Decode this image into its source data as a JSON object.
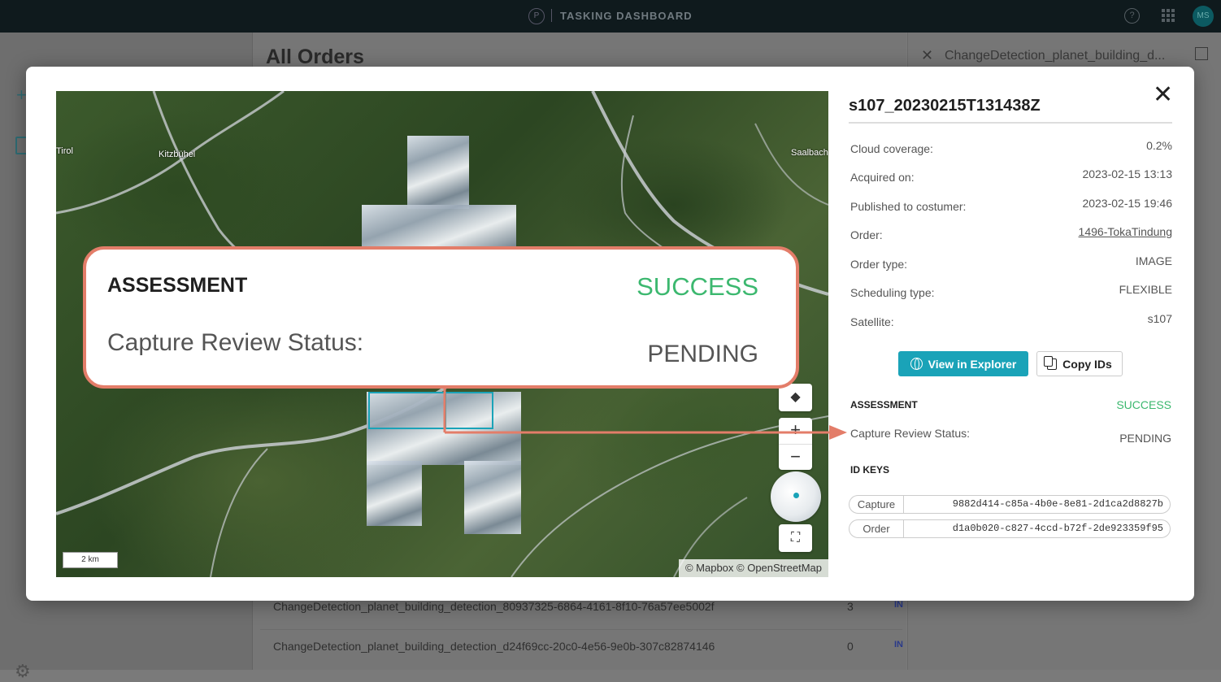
{
  "app": {
    "title": "TASKING DASHBOARD",
    "logo_glyph": "P",
    "avatar_initials": "MS",
    "help_glyph": "?"
  },
  "background": {
    "heading": "All Orders",
    "panel_title": "ChangeDetection_planet_building_d...",
    "rows": [
      {
        "name": "ChangeDetection_planet_building_detection_80937325-6864-4161-8f10-76a57ee5002f",
        "count": "3",
        "badge": "IN"
      },
      {
        "name": "ChangeDetection_planet_building_detection_d24f69cc-20c0-4e56-9e0b-307c82874146",
        "count": "0",
        "badge": "IN"
      }
    ]
  },
  "map": {
    "labels": [
      {
        "text": "Tirol"
      },
      {
        "text": "Kitzbühel"
      },
      {
        "text": "Saalbach"
      }
    ],
    "scale": "2 km",
    "attribution": "© Mapbox © OpenStreetMap",
    "zoom_in": "+",
    "zoom_out": "−"
  },
  "callout": {
    "title": "ASSESSMENT",
    "status": "SUCCESS",
    "label": "Capture Review Status:",
    "value": "PENDING",
    "color": "#e37d69"
  },
  "details": {
    "title": "s107_20230215T131438Z",
    "close_glyph": "✕",
    "rows": [
      {
        "label": "Cloud coverage:",
        "value": "0.2%"
      },
      {
        "label": "Acquired on:",
        "value": "2023-02-15 13:13"
      },
      {
        "label": "Published to costumer:",
        "value": "2023-02-15 19:46"
      },
      {
        "label": "Order:",
        "value": "1496-TokaTindung"
      },
      {
        "label": "Order type:",
        "value": "IMAGE"
      },
      {
        "label": "Scheduling type:",
        "value": "FLEXIBLE"
      },
      {
        "label": "Satellite:",
        "value": "s107"
      }
    ],
    "view_button": "View in Explorer",
    "copy_button": "Copy IDs",
    "assessment_label": "ASSESSMENT",
    "assessment_value": "SUCCESS",
    "review_label": "Capture Review Status:",
    "review_value": "PENDING",
    "id_keys_heading": "ID KEYS",
    "ids": [
      {
        "key": "Capture",
        "value": "9882d414-c85a-4b0e-8e81-2d1ca2d8827b"
      },
      {
        "key": "Order",
        "value": "d1a0b020-c827-4ccd-b72f-2de923359f95"
      }
    ]
  },
  "colors": {
    "accent": "#1aa3b8",
    "success": "#3cb86f",
    "annotation": "#e37d69"
  }
}
